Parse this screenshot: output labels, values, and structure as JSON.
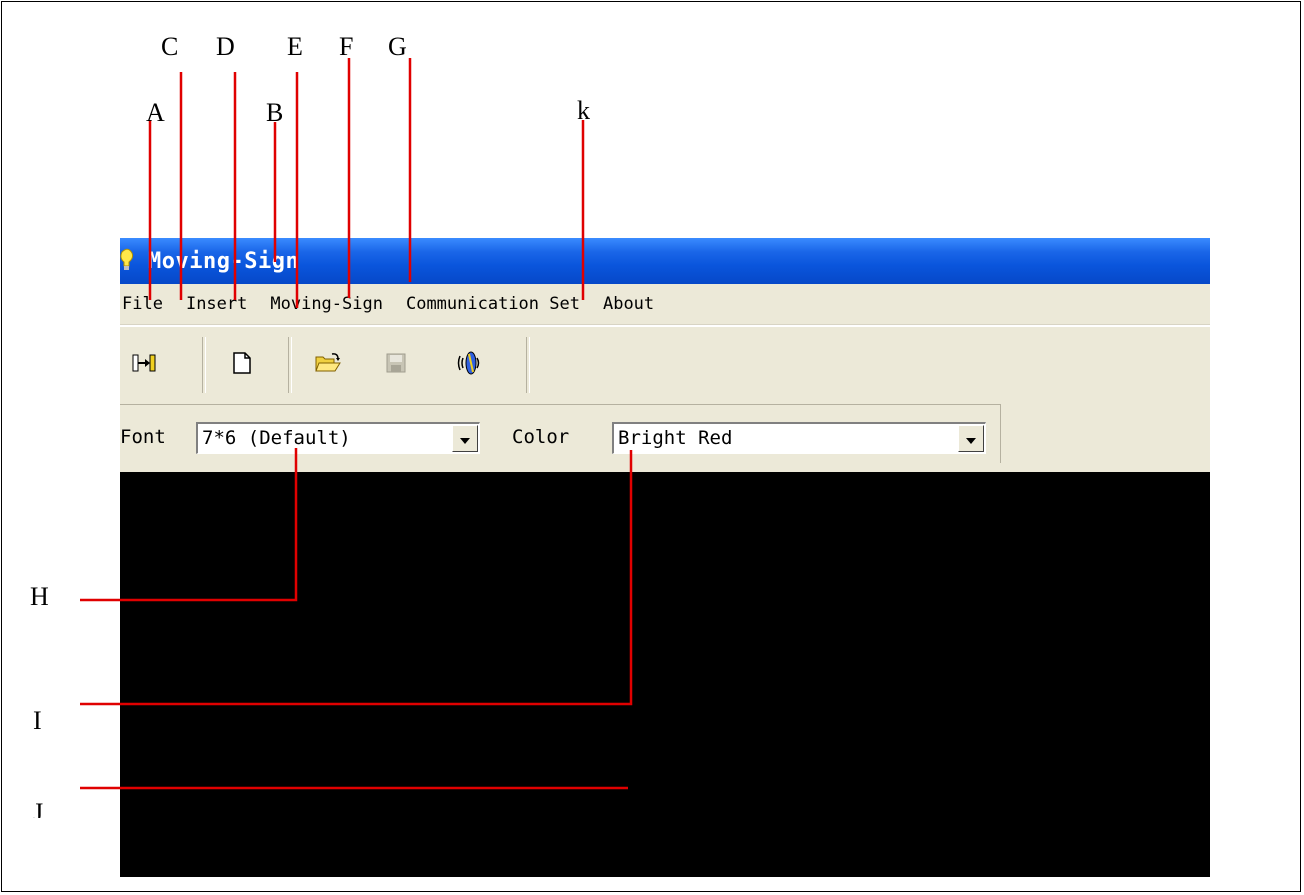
{
  "window": {
    "title": "Moving-Sign",
    "title_icon": "lightbulb-icon",
    "titlebar_color": "#0a55dc"
  },
  "menu": {
    "items": [
      "File",
      "Insert",
      "Moving-Sign",
      "Communication Set",
      "About"
    ]
  },
  "toolbar": {
    "buttons": [
      {
        "icon": "connect-icon"
      },
      {
        "icon": "new-document-icon"
      },
      {
        "icon": "open-folder-icon"
      },
      {
        "icon": "save-disk-icon",
        "disabled": true
      },
      {
        "icon": "send-sound-icon"
      }
    ]
  },
  "fontbar": {
    "font_label": "Font",
    "font_value": "7*6 (Default)",
    "color_label": "Color",
    "color_value": "Bright Red"
  },
  "display": {
    "background": "#000000"
  },
  "annotations": {
    "labels": [
      "A",
      "B",
      "C",
      "D",
      "E",
      "F",
      "G",
      "k",
      "H",
      "I",
      "J"
    ],
    "line_color": "#e00000"
  }
}
